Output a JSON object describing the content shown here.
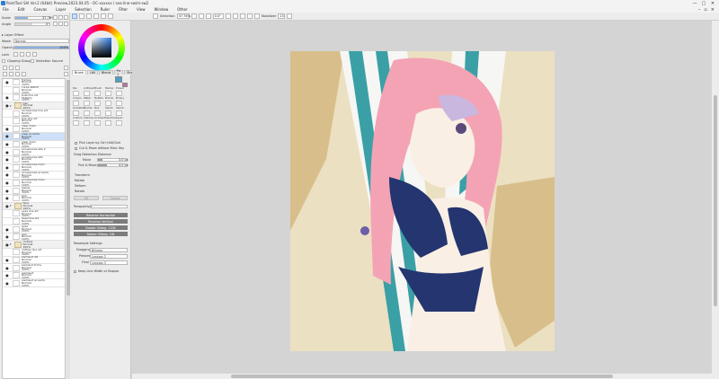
{
  "window": {
    "title": "PaintTool SAI Ver.2 (64bit) Preview.2023.04.05 - OC-xxxxxx / sea-line-swim-sw2",
    "controls": [
      "—",
      "□",
      "✕"
    ]
  },
  "menu": {
    "items": [
      "File",
      "Edit",
      "Canvas",
      "Layer",
      "Selection",
      "Ruler",
      "Filter",
      "View",
      "Window",
      "Other"
    ]
  },
  "toolbar": {
    "selection_label": "Selection",
    "zoom_value": "37.76%",
    "angle_value": "0.0°",
    "stabilizer_label": "Stabilizer",
    "stabilizer_value": "13"
  },
  "left_panel": {
    "scale_label": "Scale",
    "scale_value": "37.76%",
    "angle_label": "Angle",
    "angle_value": "0°",
    "layer_effect_label": "Layer Effect",
    "mode_label": "Mode",
    "mode_value": "Normal",
    "opacity_label": "Opacity",
    "opacity_value": "100%",
    "lock_label": "Lock",
    "clipping_label": "Clipping Group",
    "selection_source_label": "Selection Source"
  },
  "layers": [
    {
      "name": "frames",
      "mode": "Normal",
      "opacity": "100%",
      "visible": true
    },
    {
      "name": "curve sketch",
      "mode": "Normal",
      "opacity": "100%",
      "visible": false
    },
    {
      "name": "bulb line art",
      "mode": "Multiply",
      "opacity": "100%",
      "visible": true
    },
    {
      "name": "hair",
      "mode": "Normal",
      "opacity": "100%",
      "visible": true,
      "folder": true
    },
    {
      "name": "accessories line art",
      "mode": "Normal",
      "opacity": "100%",
      "visible": false
    },
    {
      "name": "hair line art",
      "mode": "Normal",
      "opacity": "100%",
      "visible": false
    },
    {
      "name": "clear main",
      "mode": "Normal",
      "opacity": "100%",
      "visible": true
    },
    {
      "name": "clear accents",
      "mode": "Normal",
      "opacity": "100%",
      "visible": true,
      "selected": true
    },
    {
      "name": "clear main",
      "mode": "Normal",
      "opacity": "100%",
      "visible": true
    },
    {
      "name": "accessories alts 2",
      "mode": "Normal",
      "opacity": "100%",
      "visible": true
    },
    {
      "name": "accessories alts",
      "mode": "Normal",
      "opacity": "100%",
      "visible": true
    },
    {
      "name": "accessories main",
      "mode": "Normal",
      "opacity": "100%",
      "visible": true
    },
    {
      "name": "accessories accents",
      "mode": "Normal",
      "opacity": "100%",
      "visible": true
    },
    {
      "name": "accessories main",
      "mode": "Normal",
      "opacity": "100%",
      "visible": true
    },
    {
      "name": "lashes",
      "mode": "Normal",
      "opacity": "100%",
      "visible": true
    },
    {
      "name": "hair",
      "mode": "Normal",
      "opacity": "100%",
      "visible": true
    },
    {
      "name": "face",
      "mode": "Normal",
      "opacity": "100%",
      "visible": true,
      "folder": true
    },
    {
      "name": "eyes line art",
      "mode": "Normal",
      "opacity": "100%",
      "visible": false
    },
    {
      "name": "head line art",
      "mode": "Normal",
      "opacity": "100%",
      "visible": false
    },
    {
      "name": "eyes",
      "mode": "Normal",
      "opacity": "100%",
      "visible": true
    },
    {
      "name": "skin",
      "mode": "Normal",
      "opacity": "100%",
      "visible": true
    },
    {
      "name": "clothes",
      "mode": "Normal",
      "opacity": "100%",
      "visible": true,
      "folder": true
    },
    {
      "name": "clothes line art",
      "mode": "Normal",
      "opacity": "100%",
      "visible": false
    },
    {
      "name": "swimsuit alt",
      "mode": "Normal",
      "opacity": "100%",
      "visible": true
    },
    {
      "name": "swimsuit trims",
      "mode": "Normal",
      "opacity": "100%",
      "visible": true
    },
    {
      "name": "swimsuit",
      "mode": "Normal",
      "opacity": "100%",
      "visible": true
    },
    {
      "name": "swimsuit accents",
      "mode": "Normal",
      "opacity": "100%",
      "visible": true
    }
  ],
  "tool_panel": {
    "tabs": [
      "Brush",
      "Util",
      "Blend",
      "Fx 1",
      "Shape"
    ],
    "tools": [
      "Pen",
      "AirBrush",
      "Brush",
      "Marker",
      "Eraser",
      "Crayon",
      "Water",
      "Bubble",
      "Blurrer",
      "Binary",
      "Gradation",
      "Bucket",
      "Blur",
      "Select",
      "Select.",
      "Custom",
      "Shadow",
      "Gradient",
      "Selection",
      "Layer"
    ],
    "pick_layer": "Pick Layer by Ctrl+Alt/Click",
    "cut_move": "Cut & Move without Mod. Key",
    "drag_detection": "Drag Detection Distance",
    "move_label": "Move",
    "move_value": "3.0 px",
    "pick_move_label": "Pick & Move",
    "pick_move_value": "4.0 px",
    "transform_label": "Transform",
    "rotate_label": "Rotate",
    "deform_label": "Deform",
    "rotate2_label": "Rotate",
    "ok_label": "OK",
    "cancel_label": "Cancel",
    "perspective_label": "Perspective",
    "btn_reverse_horizontal": "Reverse Horizontal",
    "btn_reverse_vertical": "Reverse Vertical",
    "btn_rotate_ccw": "Rotate 90deg. CCW",
    "btn_rotate_cw": "Rotate 90deg. CW",
    "resample_label": "Resample Settings",
    "dragging_label": "Dragging",
    "dragging_value": "Bilinear",
    "preview_label": "Preview",
    "preview_value": "Lanczos 2",
    "final_label": "Final",
    "final_value": "Lanczos 3",
    "keep_width_label": "Keep Line Width of Shapes"
  },
  "colors": {
    "primary_swatch": "#4fa0c6",
    "secondary_swatch": "#c86ba8",
    "canvas_bg": "#ece0c2",
    "stripe_sand": "#d9be86",
    "stripe_teal": "#3aa0a6",
    "hair_pink": "#f4a3b5",
    "swimsuit_navy": "#24356f"
  }
}
